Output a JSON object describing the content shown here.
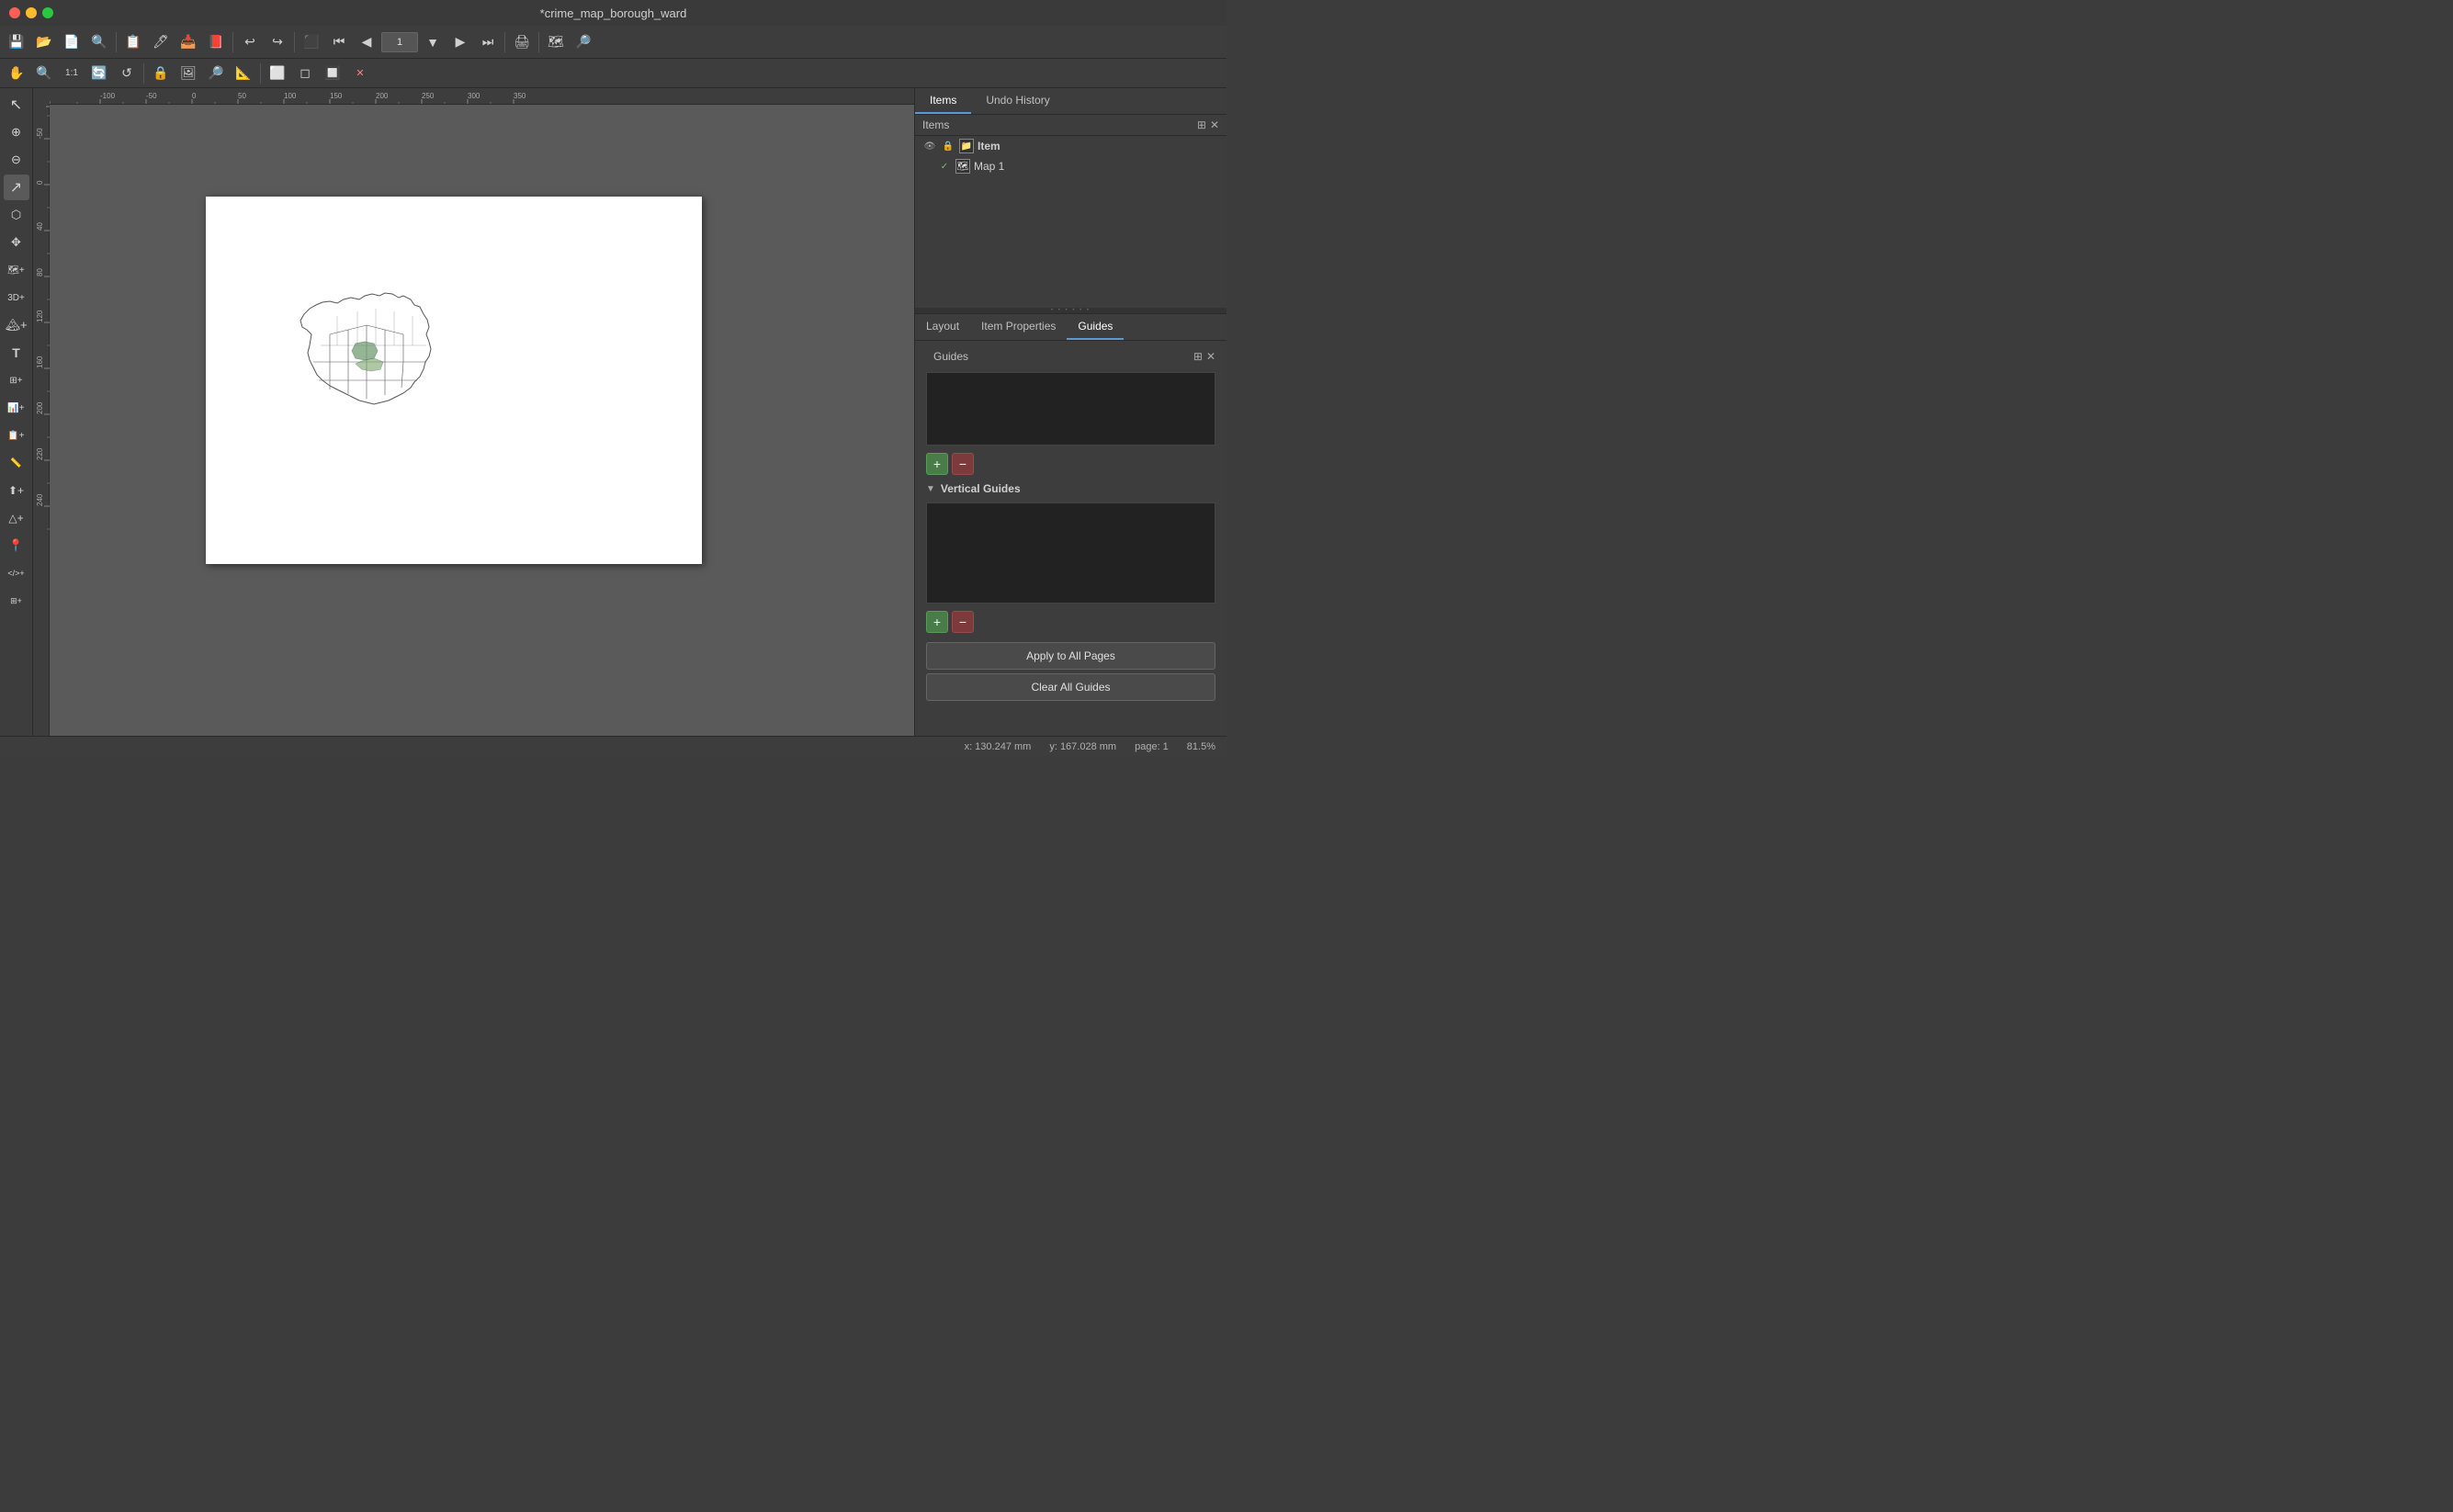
{
  "titlebar": {
    "title": "*crime_map_borough_ward"
  },
  "toolbar": {
    "page_input": "1",
    "buttons": [
      "save",
      "open",
      "new",
      "search",
      "browse",
      "compose",
      "export",
      "print",
      "folder",
      "atlas",
      "page_prev",
      "page_next",
      "page_last",
      "refresh",
      "atlas_settings",
      "zoom"
    ]
  },
  "items_panel": {
    "header_label": "Items",
    "tab_items": "Items",
    "tab_undo": "Undo History",
    "items": [
      {
        "label": "Item",
        "has_eye": true,
        "has_lock": true,
        "is_group": true
      },
      {
        "label": "Map 1",
        "has_check": true,
        "is_map": true
      }
    ]
  },
  "bottom_panel": {
    "tab_layout": "Layout",
    "tab_item_properties": "Item Properties",
    "tab_guides": "Guides",
    "guides_label": "Guides",
    "vertical_guides_label": "Vertical Guides",
    "add_guide_tooltip": "+",
    "remove_guide_tooltip": "-",
    "apply_btn_label": "Apply to All Pages",
    "clear_btn_label": "Clear All Guides"
  },
  "statusbar": {
    "x": "x: 130.247 mm",
    "y": "y: 167.028 mm",
    "page": "page: 1",
    "zoom": "81.5%"
  },
  "ruler": {
    "h_ticks": [
      -100,
      -50,
      0,
      50,
      100,
      150,
      200,
      250,
      300,
      350
    ],
    "h_labels": [
      "-100",
      "-50",
      "0",
      "50",
      "100",
      "150",
      "200",
      "250",
      "300",
      "350"
    ]
  }
}
